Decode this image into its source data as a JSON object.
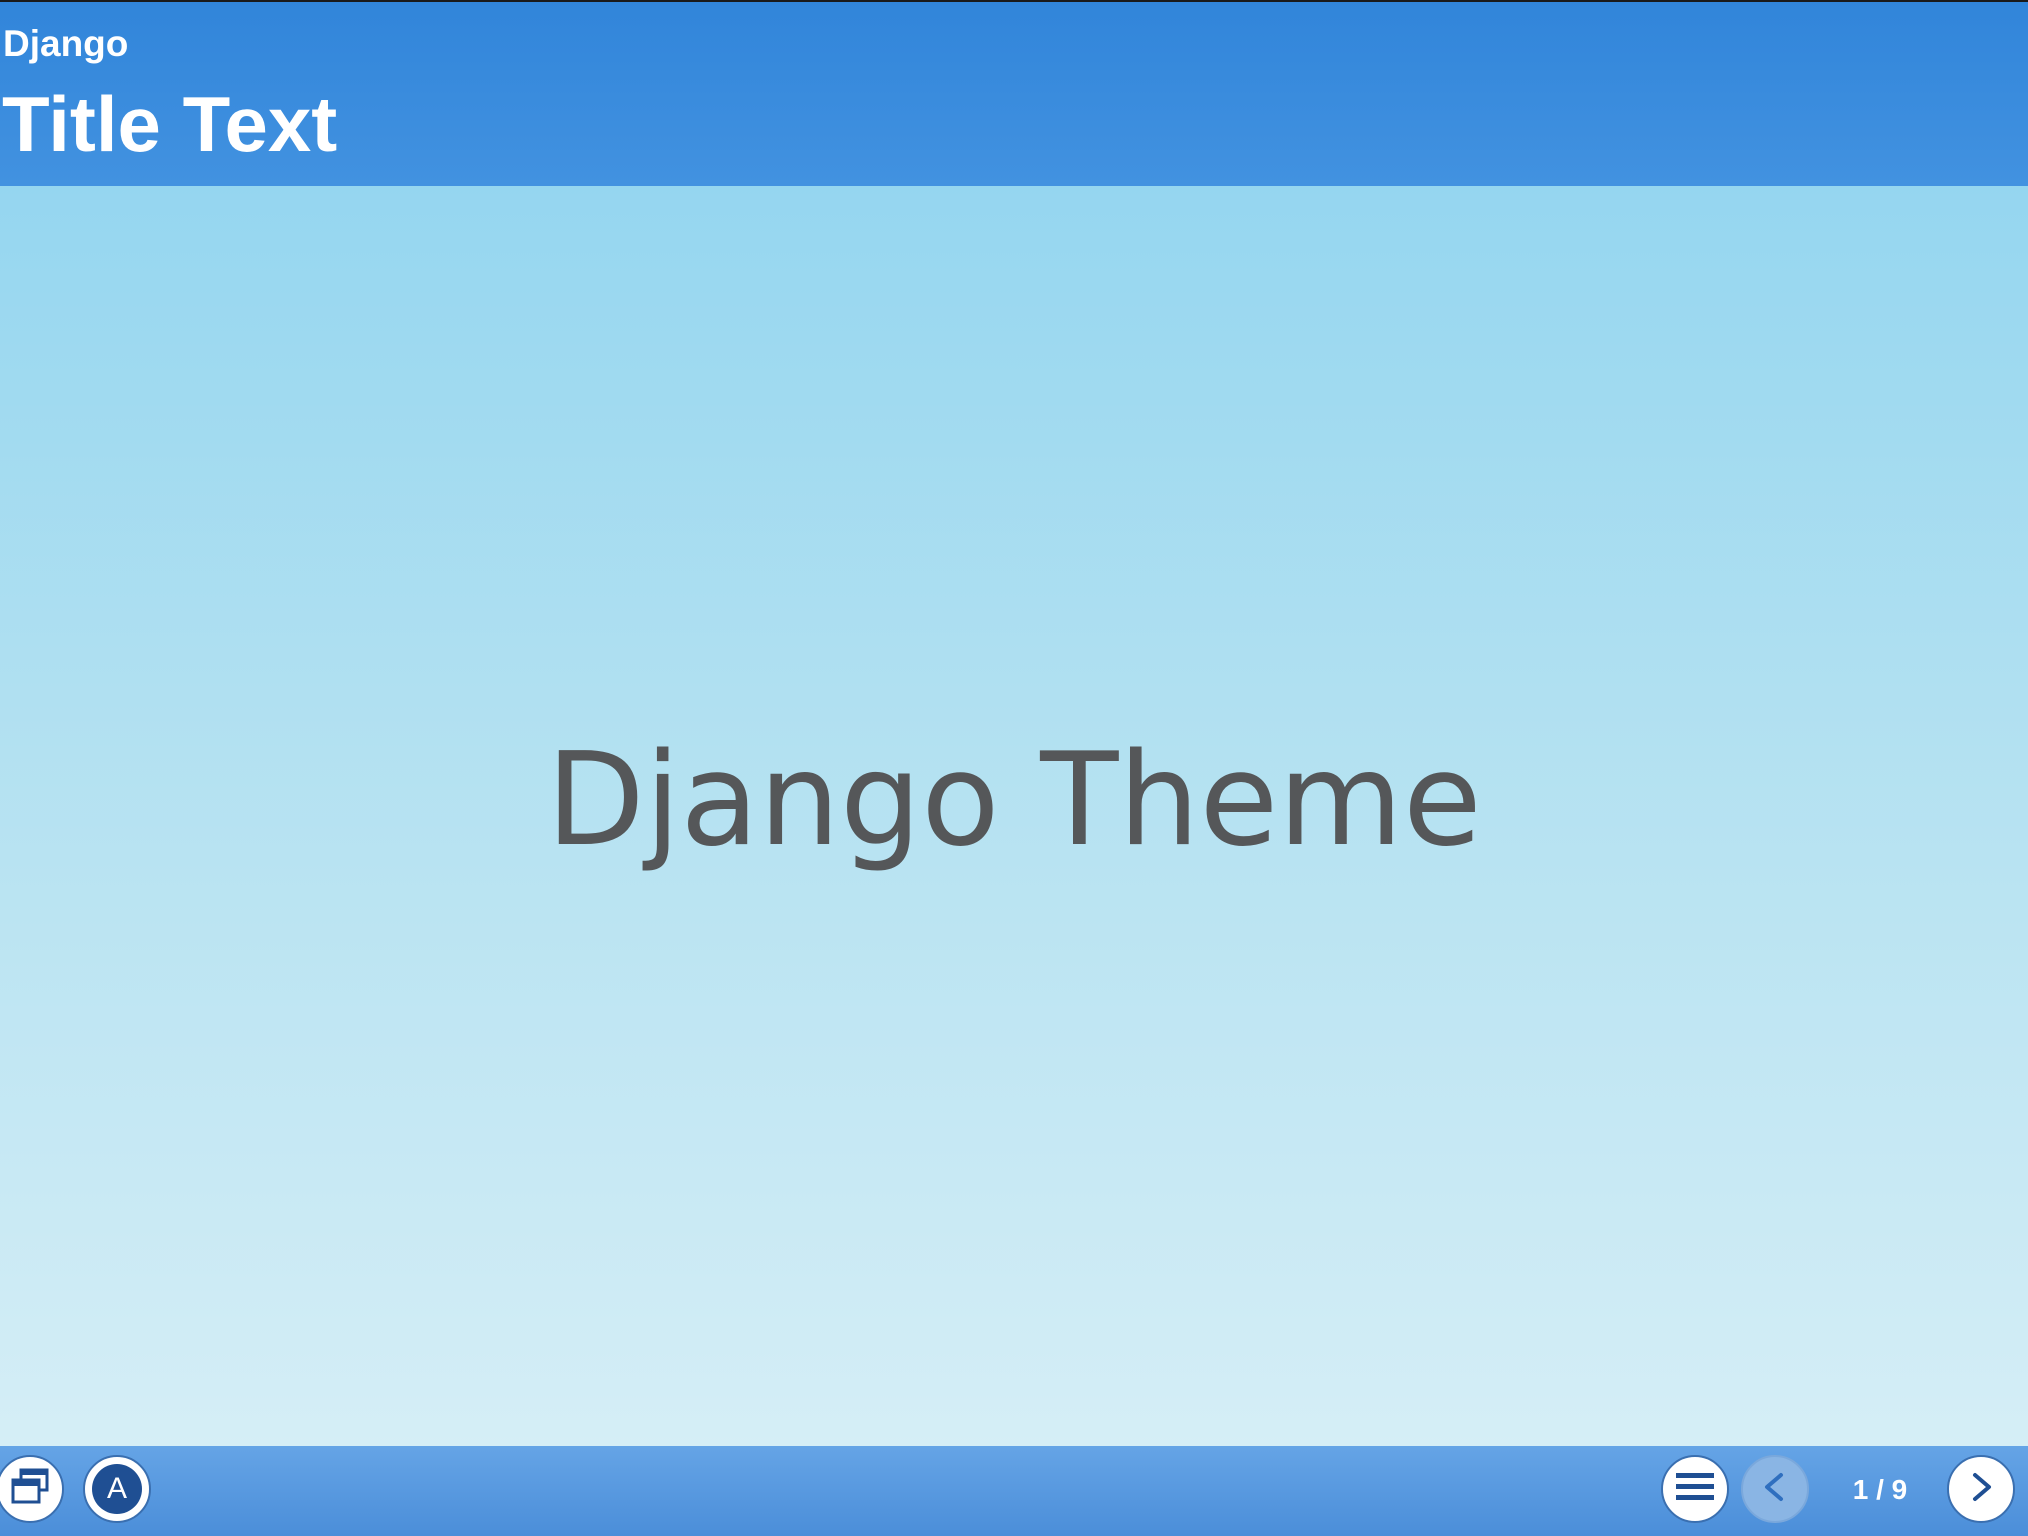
{
  "header": {
    "subtitle": "Django",
    "title": "Title Text"
  },
  "slide": {
    "main_text": "Django Theme"
  },
  "footer": {
    "windows_icon": "windows-icon",
    "accessibility_label": "A",
    "menu_icon": "hamburger-menu-icon",
    "prev_icon": "chevron-left-icon",
    "next_icon": "chevron-right-icon",
    "page_counter": "1 / 9",
    "prev_disabled": true
  },
  "colors": {
    "header_blue": "#3185da",
    "slide_top": "#95d6f0",
    "slide_bottom": "#d5eef6",
    "text_gray": "#555759",
    "footer_blue": "#5a9be3",
    "icon_navy": "#1f4f93"
  }
}
